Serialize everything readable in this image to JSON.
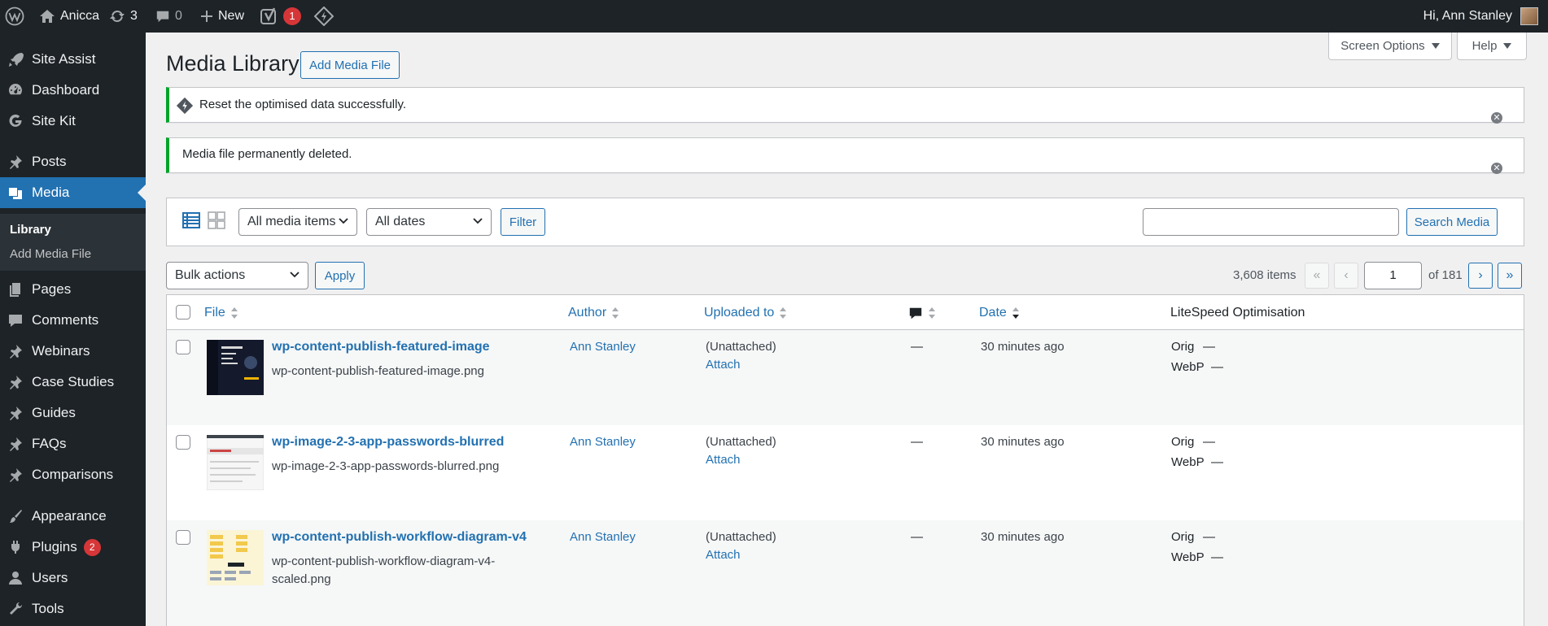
{
  "adminbar": {
    "site_name": "Anicca",
    "updates_count": "3",
    "comments_count": "0",
    "new_label": "New",
    "yoast_badge": "1",
    "greeting": "Hi, Ann Stanley"
  },
  "sidebar": {
    "items": {
      "site_assist": "Site Assist",
      "dashboard": "Dashboard",
      "site_kit": "Site Kit",
      "posts": "Posts",
      "media": "Media",
      "pages": "Pages",
      "comments": "Comments",
      "webinars": "Webinars",
      "case_studies": "Case Studies",
      "guides": "Guides",
      "faqs": "FAQs",
      "comparisons": "Comparisons",
      "appearance": "Appearance",
      "plugins": "Plugins",
      "users": "Users",
      "tools": "Tools"
    },
    "plugins_count": "2",
    "submenu": {
      "library": "Library",
      "add_media_file": "Add Media File"
    }
  },
  "header": {
    "screen_options": "Screen Options",
    "help": "Help",
    "title": "Media Library",
    "add_media_file": "Add Media File"
  },
  "notices": {
    "litespeed": "Reset the optimised data successfully.",
    "deleted": "Media file permanently deleted."
  },
  "filters": {
    "media_type": "All media items",
    "dates": "All dates",
    "filter_button": "Filter",
    "search_value": "",
    "search_button": "Search Media"
  },
  "bulk": {
    "action": "Bulk actions",
    "apply": "Apply"
  },
  "pagination": {
    "items_count": "3,608 items",
    "first": "«",
    "prev": "‹",
    "current_page": "1",
    "of_total": "of 181",
    "next": "›",
    "last": "»"
  },
  "table": {
    "columns": {
      "file": "File",
      "author": "Author",
      "uploaded_to": "Uploaded to",
      "date": "Date",
      "litespeed": "LiteSpeed Optimisation"
    },
    "rows": [
      {
        "title": "wp-content-publish-featured-image",
        "filename": "wp-content-publish-featured-image.png",
        "author": "Ann Stanley",
        "uploaded_to": "(Unattached)",
        "attach": "Attach",
        "comments": "—",
        "date": "30 minutes ago",
        "orig": "Orig",
        "orig_value": "—",
        "webp": "WebP",
        "webp_value": "—"
      },
      {
        "title": "wp-image-2-3-app-passwords-blurred",
        "filename": "wp-image-2-3-app-passwords-blurred.png",
        "author": "Ann Stanley",
        "uploaded_to": "(Unattached)",
        "attach": "Attach",
        "comments": "—",
        "date": "30 minutes ago",
        "orig": "Orig",
        "orig_value": "—",
        "webp": "WebP",
        "webp_value": "—"
      },
      {
        "title": "wp-content-publish-workflow-diagram-v4",
        "filename": "wp-content-publish-workflow-diagram-v4-scaled.png",
        "author": "Ann Stanley",
        "uploaded_to": "(Unattached)",
        "attach": "Attach",
        "comments": "—",
        "date": "30 minutes ago",
        "orig": "Orig",
        "orig_value": "—",
        "webp": "WebP",
        "webp_value": "—"
      }
    ]
  },
  "colors": {
    "admin_bar": "#1d2327",
    "accent": "#2271b1",
    "notice_success": "#00a32a",
    "badge": "#d63638"
  }
}
